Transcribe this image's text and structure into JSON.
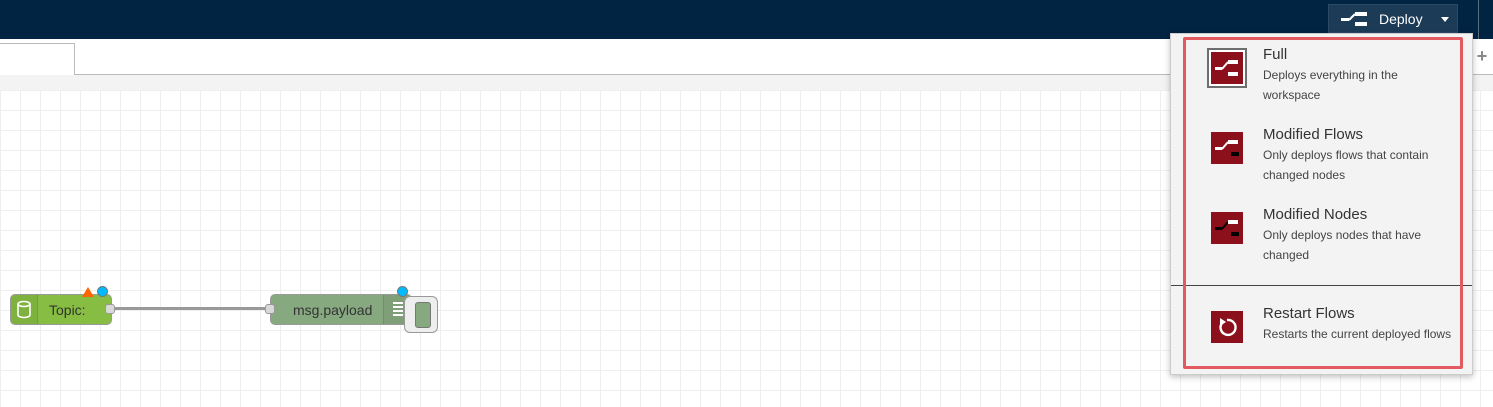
{
  "header": {
    "deploy_label": "Deploy"
  },
  "flow": {
    "nodes": [
      {
        "label": "Topic:"
      },
      {
        "label": "msg.payload"
      }
    ]
  },
  "deploy_menu": {
    "items": [
      {
        "title": "Full",
        "description": "Deploys everything in the workspace"
      },
      {
        "title": "Modified Flows",
        "description": "Only deploys flows that contain changed nodes"
      },
      {
        "title": "Modified Nodes",
        "description": "Only deploys nodes that have changed"
      },
      {
        "title": "Restart Flows",
        "description": "Restarts the current deployed flows"
      }
    ]
  },
  "colors": {
    "header_bg": "#022443",
    "menu_icon_bg": "#8c101c",
    "highlight_border": "#e25a5f",
    "inject_node": "#87bd42",
    "debug_node": "#87a980"
  }
}
